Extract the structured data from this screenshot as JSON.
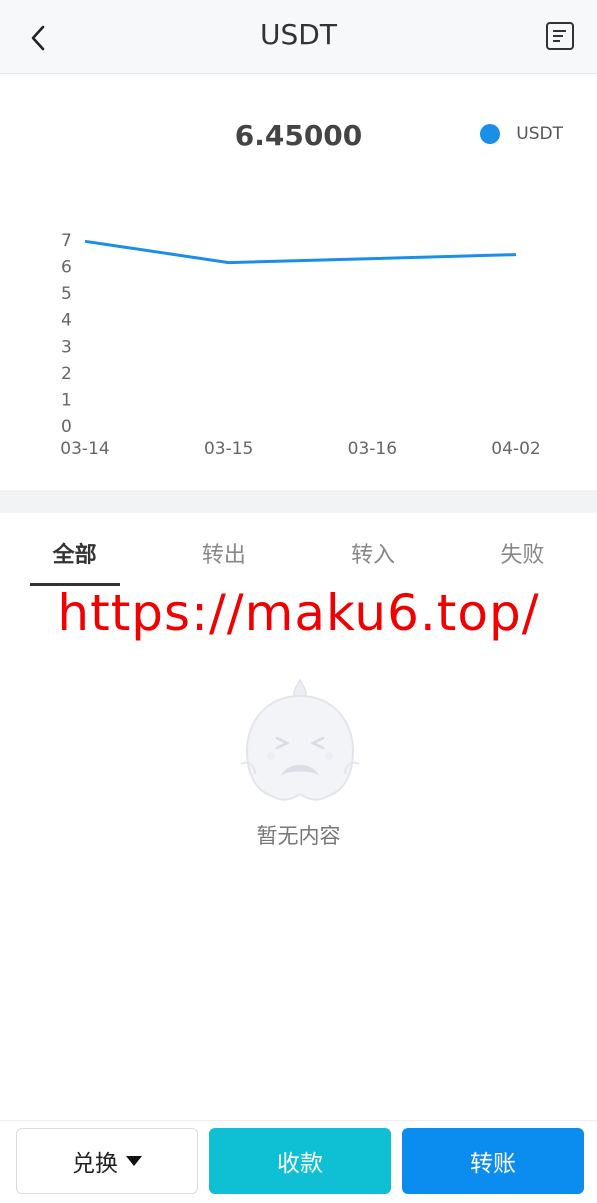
{
  "header": {
    "title": "USDT",
    "back_icon": "chevron-left-icon",
    "record_icon": "document-list-icon"
  },
  "chart": {
    "current_value": "6.45000",
    "legend_label": "USDT",
    "accent_color": "#1a8fe8"
  },
  "chart_data": {
    "type": "line",
    "categories": [
      "03-14",
      "03-15",
      "03-16",
      "04-02"
    ],
    "series": [
      {
        "name": "USDT",
        "values": [
          6.95,
          6.15,
          6.3,
          6.45
        ]
      }
    ],
    "yticks": [
      "0",
      "1",
      "2",
      "3",
      "4",
      "5",
      "6",
      "7"
    ],
    "ylim": [
      0,
      7
    ],
    "legend": "top-right",
    "grid": false
  },
  "tabs": [
    {
      "label": "全部",
      "active": true
    },
    {
      "label": "转出",
      "active": false
    },
    {
      "label": "转入",
      "active": false
    },
    {
      "label": "失败",
      "active": false
    }
  ],
  "watermark": "https://maku6.top/",
  "empty": {
    "text": "暂无内容"
  },
  "actions": {
    "exchange_label": "兑换",
    "receive_label": "收款",
    "transfer_label": "转账",
    "receive_color": "#0fc0d4",
    "transfer_color": "#0b8cef"
  }
}
